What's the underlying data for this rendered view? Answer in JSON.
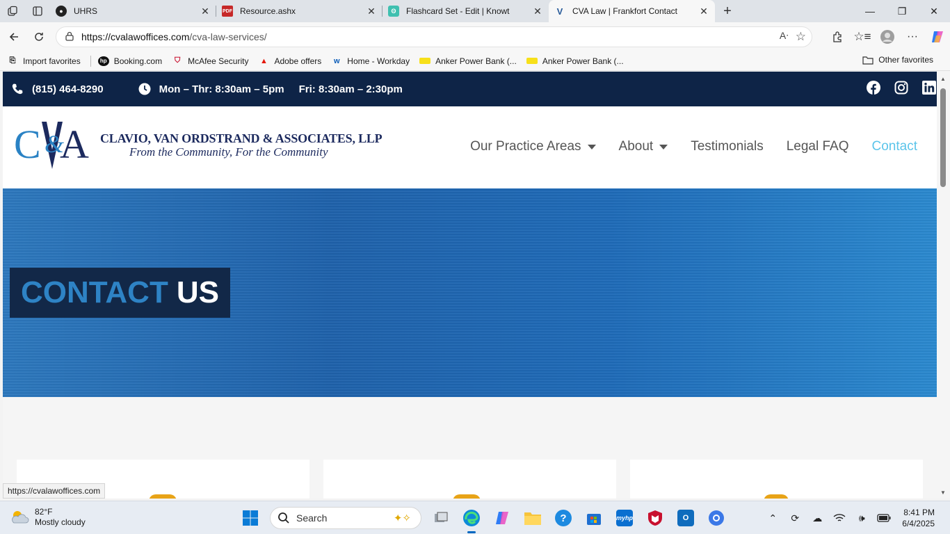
{
  "browser": {
    "tabs": [
      {
        "label": "UHRS",
        "active": false
      },
      {
        "label": "Resource.ashx",
        "active": false
      },
      {
        "label": "Flashcard Set - Edit | Knowt",
        "active": false
      },
      {
        "label": "CVA Law | Frankfort Contact",
        "active": true
      }
    ],
    "url_host": "https://cvalawoffices.com",
    "url_path": "/cva-law-services/",
    "favorites": [
      {
        "label": "Import favorites",
        "icon": "import-icon"
      },
      {
        "label": "Booking.com",
        "icon": "hp-icon"
      },
      {
        "label": "McAfee Security",
        "icon": "mcafee-icon"
      },
      {
        "label": "Adobe offers",
        "icon": "adobe-icon"
      },
      {
        "label": "Home - Workday",
        "icon": "workday-icon"
      },
      {
        "label": "Anker Power Bank (...",
        "icon": "tag-icon"
      },
      {
        "label": "Anker Power Bank (...",
        "icon": "tag-icon"
      }
    ],
    "other_favorites": "Other favorites",
    "status_url": "https://cvalawoffices.com"
  },
  "site": {
    "topbar": {
      "phone": "(815) 464-8290",
      "hours_weekday": "Mon – Thr: 8:30am – 5pm",
      "hours_friday": "Fri: 8:30am – 2:30pm"
    },
    "logo_monogram": "C&VA",
    "firm_name": "CLAVIO, VAN ORDSTRAND & ASSOCIATES, LLP",
    "tagline": "From the Community, For the Community",
    "nav": [
      {
        "label": "Our Practice Areas",
        "dropdown": true
      },
      {
        "label": "About",
        "dropdown": true
      },
      {
        "label": "Testimonials",
        "dropdown": false
      },
      {
        "label": "Legal FAQ",
        "dropdown": false
      },
      {
        "label": "Contact",
        "dropdown": false,
        "active": true
      }
    ],
    "hero": {
      "title_part1": "CONTACT",
      "title_part2": "US"
    },
    "colors": {
      "navy": "#0e2447",
      "accent": "#5bc4ea",
      "hero_blue": "#1f62ab",
      "title_blue": "#2e83c5"
    }
  },
  "taskbar": {
    "weather_temp": "82°F",
    "weather_desc": "Mostly cloudy",
    "search_placeholder": "Search",
    "time": "8:41 PM",
    "date": "6/4/2025"
  }
}
